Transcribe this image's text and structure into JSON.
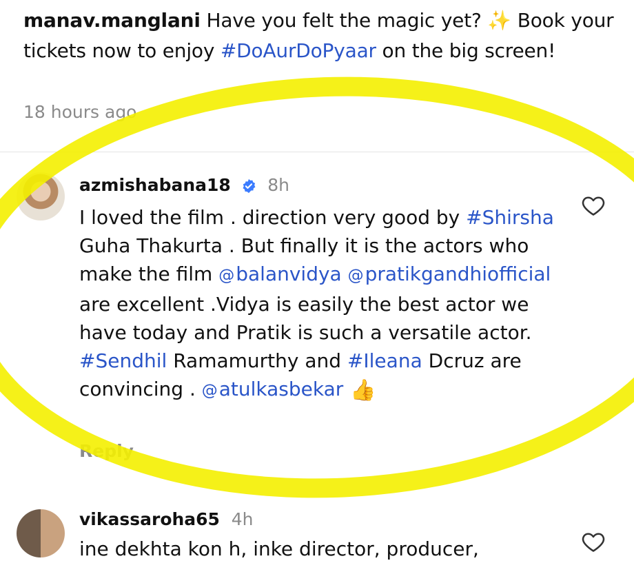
{
  "post": {
    "author": "manav.manglani",
    "caption_before": " Have you felt the magic yet? ",
    "sparkles": "✨",
    "caption_line2_before": " Book your tickets now to enjoy ",
    "hashtag": "#DoAurDoPyaar",
    "caption_after": " on the big screen!",
    "timestamp": "18 hours ago"
  },
  "comments": [
    {
      "user": "azmishabana18",
      "verified": true,
      "time": "8h",
      "text_parts": [
        {
          "kind": "text",
          "value": "I loved the film . direction very good  by "
        },
        {
          "kind": "link",
          "value": "#Shirsha"
        },
        {
          "kind": "text",
          "value": " Guha Thakurta . But finally it is the actors who make the film "
        },
        {
          "kind": "mention",
          "value": "balanvidya"
        },
        {
          "kind": "text",
          "value": " "
        },
        {
          "kind": "mention",
          "value": "pratikgandhiofficial"
        },
        {
          "kind": "text",
          "value": " are excellent .Vidya is easily the best actor we have today and Pratik is such a versatile actor. "
        },
        {
          "kind": "link",
          "value": "#Sendhil"
        },
        {
          "kind": "text",
          "value": " Ramamurthy and "
        },
        {
          "kind": "link",
          "value": "#Ileana"
        },
        {
          "kind": "text",
          "value": " Dcruz are convincing . "
        },
        {
          "kind": "mention",
          "value": "atulkasbekar"
        }
      ],
      "emoji": "👍",
      "reply_label": "Reply"
    },
    {
      "user": "vikassaroha65",
      "verified": false,
      "time": "4h",
      "text": "ine dekhta kon h, inke director, producer,"
    }
  ],
  "colors": {
    "link": "#2a55c8",
    "muted": "#8a8a8a",
    "highlight": "#f4f000"
  }
}
